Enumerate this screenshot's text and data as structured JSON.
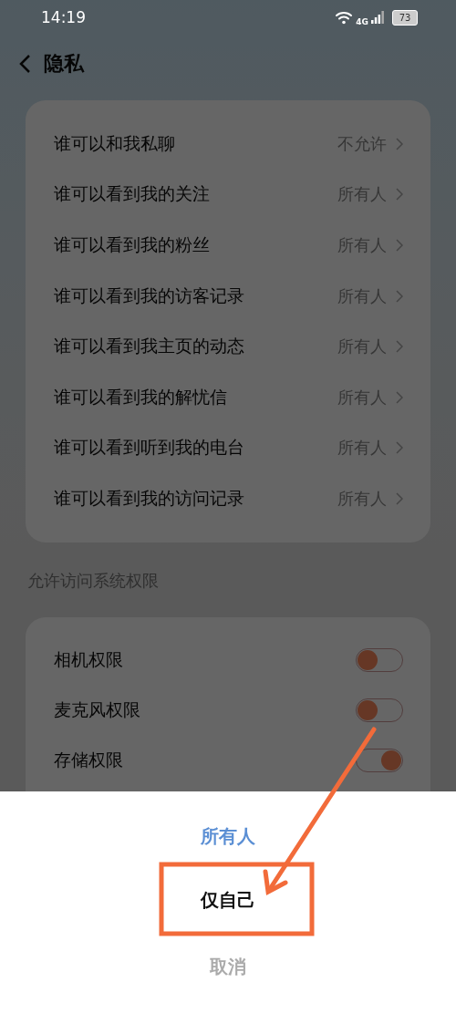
{
  "status_bar": {
    "time": "14:19",
    "network": "4G",
    "battery": "73"
  },
  "header": {
    "title": "隐私"
  },
  "privacy_items": [
    {
      "label": "谁可以和我私聊",
      "value": "不允许"
    },
    {
      "label": "谁可以看到我的关注",
      "value": "所有人"
    },
    {
      "label": "谁可以看到我的粉丝",
      "value": "所有人"
    },
    {
      "label": "谁可以看到我的访客记录",
      "value": "所有人"
    },
    {
      "label": "谁可以看到我主页的动态",
      "value": "所有人"
    },
    {
      "label": "谁可以看到我的解忧信",
      "value": "所有人"
    },
    {
      "label": "谁可以看到听到我的电台",
      "value": "所有人"
    },
    {
      "label": "谁可以看到我的访问记录",
      "value": "所有人"
    }
  ],
  "permissions_section": {
    "title": "允许访问系统权限"
  },
  "permissions": [
    {
      "label": "相机权限",
      "on": false
    },
    {
      "label": "麦克风权限",
      "on": false
    },
    {
      "label": "存储权限",
      "on": true
    }
  ],
  "sheet_options": [
    {
      "label": "所有人",
      "kind": "option",
      "selected": true
    },
    {
      "label": "仅自己",
      "kind": "option",
      "selected": false
    },
    {
      "label": "取消",
      "kind": "cancel"
    }
  ]
}
